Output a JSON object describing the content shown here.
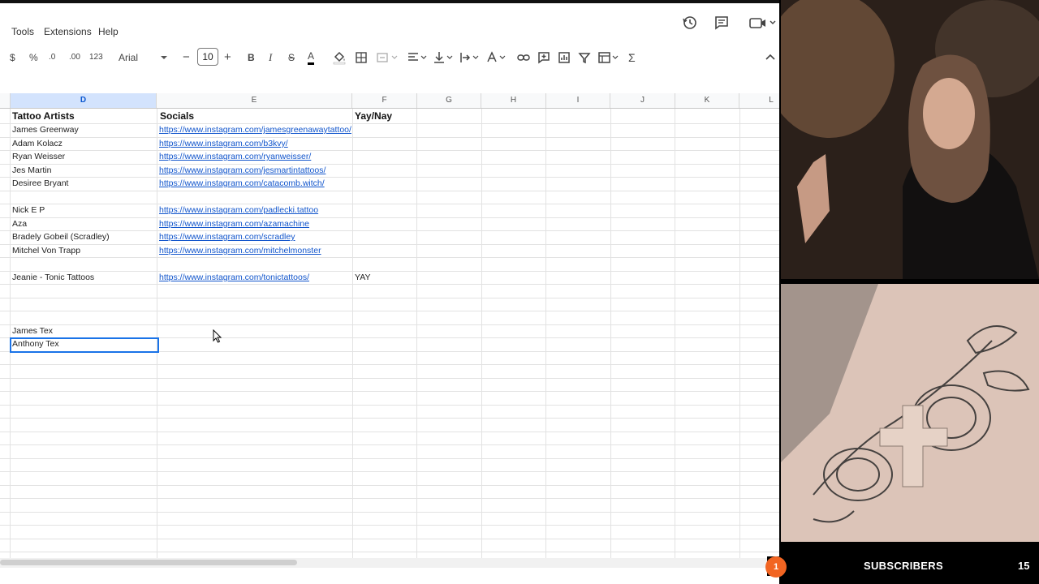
{
  "menu": {
    "items": [
      "Tools",
      "Extensions",
      "Help"
    ]
  },
  "top_icons": [
    "history-icon",
    "comment-icon",
    "meet-camera-icon"
  ],
  "toolbar": {
    "currency": "$",
    "percent": "%",
    "decrease_decimal": ".0",
    "increase_decimal": ".00",
    "number_format": "123",
    "font": "Arial",
    "font_size": "10",
    "minus": "−",
    "plus": "+",
    "bold": "B",
    "italic": "I",
    "strike": "S",
    "text_color": "A",
    "function": "Σ"
  },
  "columns": [
    "D",
    "E",
    "F",
    "G",
    "H",
    "I",
    "J",
    "K",
    "L"
  ],
  "selected_column": "D",
  "headers": {
    "d": "Tattoo Artists",
    "e": "Socials",
    "f": "Yay/Nay"
  },
  "rows": [
    {
      "artist": "James Greenway",
      "social": "https://www.instagram.com/jamesgreenawaytattoo/",
      "yay": ""
    },
    {
      "artist": "Adam Kolacz",
      "social": "https://www.instagram.com/b3kvy/",
      "yay": ""
    },
    {
      "artist": "Ryan Weisser",
      "social": "https://www.instagram.com/ryanweisser/",
      "yay": ""
    },
    {
      "artist": "Jes Martin",
      "social": "https://www.instagram.com/jesmartintattoos/",
      "yay": ""
    },
    {
      "artist": "Desiree Bryant",
      "social": "https://www.instagram.com/catacomb.witch/",
      "yay": ""
    },
    {
      "artist": "",
      "social": "",
      "yay": ""
    },
    {
      "artist": "Nick E P",
      "social": "https://www.instagram.com/padlecki.tattoo",
      "yay": ""
    },
    {
      "artist": "Aza",
      "social": "https://www.instagram.com/azamachine",
      "yay": ""
    },
    {
      "artist": "Bradely Gobeil (Scradley)",
      "social": "https://www.instagram.com/scradley",
      "yay": ""
    },
    {
      "artist": "Mitchel Von Trapp",
      "social": "https://www.instagram.com/mitchelmonster",
      "yay": ""
    },
    {
      "artist": "",
      "social": "",
      "yay": ""
    },
    {
      "artist": "Jeanie - Tonic Tattoos",
      "social": "https://www.instagram.com/tonictattoos/",
      "yay": "YAY"
    },
    {
      "artist": "",
      "social": "",
      "yay": ""
    },
    {
      "artist": "",
      "social": "",
      "yay": ""
    },
    {
      "artist": "",
      "social": "",
      "yay": ""
    },
    {
      "artist": "James Tex",
      "social": "",
      "yay": ""
    },
    {
      "artist": "Anthony Tex",
      "social": "",
      "yay": ""
    }
  ],
  "selected_cell_value": "Anthony Tex",
  "stream_overlay": {
    "badge": "1",
    "label": "SUBSCRIBERS",
    "count": "15"
  },
  "colors": {
    "link": "#1155cc",
    "selection": "#1a73e8",
    "badge": "#f26522"
  }
}
